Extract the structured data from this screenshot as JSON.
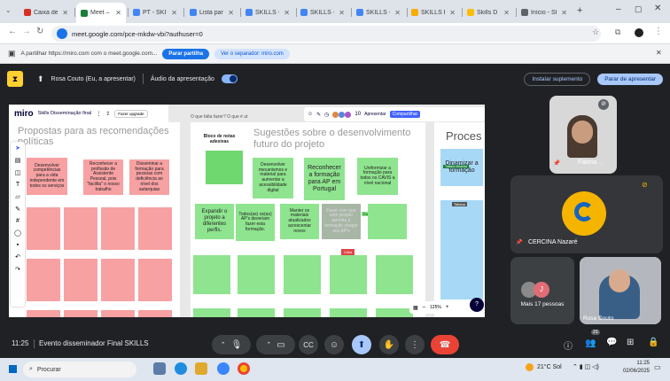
{
  "browser": {
    "tabs": [
      {
        "label": "Caixa de e",
        "color": "#d93025"
      },
      {
        "label": "Meet –",
        "color": "#188038"
      },
      {
        "label": "PT - SKILL",
        "color": "#4285f4"
      },
      {
        "label": "Lista partic",
        "color": "#4285f4"
      },
      {
        "label": "SKILLS - D",
        "color": "#4285f4"
      },
      {
        "label": "SKILLS - D",
        "color": "#4285f4"
      },
      {
        "label": "SKILLS - D",
        "color": "#4285f4"
      },
      {
        "label": "SKILLS Eve",
        "color": "#f9ab00"
      },
      {
        "label": "Skills D",
        "color": "#fbbc04"
      },
      {
        "label": "Início - Sh",
        "color": "#5f6368"
      }
    ],
    "url": "meet.google.com/pce-mkdw-vbi?authuser=0"
  },
  "share_notice": {
    "text": "A partilhar https://miro.com com o meet.google.com...",
    "stop_label": "Parar partilha",
    "switch_label": "Ver o separador: miro.com"
  },
  "presenting": {
    "presenter": "Rosa Couto (Eu, a apresentar)",
    "audio_label": "Áudio da apresentação",
    "install_label": "Instalar suplemento",
    "stop_label": "Parar de apresentar"
  },
  "miro": {
    "logo": "miro",
    "board_name": "Skills Disseminação final",
    "upgrade": "Fazer upgrade",
    "frame_label": "O que falta fazer? O que é ut",
    "present_btn": "Apresentar",
    "share_btn": "Compartilhar",
    "user_count": "10",
    "zoom": "125%",
    "col1_title": "Propostas para as recomendações políticas",
    "col1_notes": [
      "Desenvolver competências para a vida independente em todos os serviços",
      "Reconhecer a profissão de Assistente Pessoal, pois \"facilita\" o nosso trabalho",
      "Disseminar a formação para pessoas com deficiência ao nível dos autarquias"
    ],
    "col2_title": "Sugestões sobre o desenvolvimento futuro do projeto",
    "col2_header_note": "Bloco de notas adesivas",
    "col2_notes": [
      "Desenvolver mecanismos e material para aumentar a acessibilidade digital",
      "Reconhecer a formação para AP em Portugal",
      "Uniformizar a formação para todos os CAVIS a nível nacional",
      "Expandir o projeto a diferentes perfis.",
      "Todos(as) os(as) AP's deveriam fazer esta formação.",
      "Manter os materiais atualizados acrescentar novos",
      "Fazer com que este projeto permita à formação chegar aos AP's"
    ],
    "col3_title": "Proces",
    "col3_note": "Dinamizar a formação",
    "tag_tatiana": "Tatiana Miranda",
    "tag_fofo": "Fofo",
    "tag_celia": "Célia",
    "tag_tatiana2": "Tatiana"
  },
  "participants": [
    {
      "name": "Fátima ..."
    },
    {
      "name": "CERCINA Nazaré"
    },
    {
      "name": "Mais 17 pessoas",
      "initial": "J"
    },
    {
      "name": "Rosa Couto"
    }
  ],
  "meeting": {
    "time": "11:25",
    "title": "Evento disseminador Final SKILLS",
    "people_count": "21"
  },
  "taskbar": {
    "search_placeholder": "Procurar",
    "weather": "21°C Sol",
    "clock_time": "11:25",
    "clock_date": "02/06/2025"
  }
}
